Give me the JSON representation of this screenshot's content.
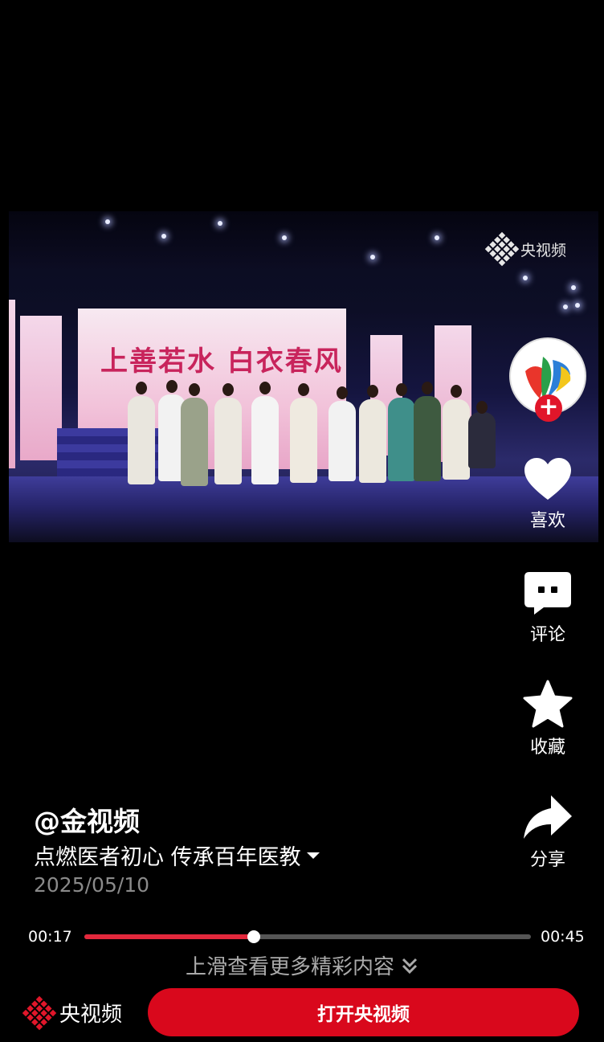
{
  "video": {
    "watermark": "央视频",
    "banner_title": "上善若水 白衣春风"
  },
  "actions": {
    "like_label": "喜欢",
    "comment_label": "评论",
    "favorite_label": "收藏",
    "share_label": "分享"
  },
  "post": {
    "author": "@金视频",
    "caption": "点燃医者初心 传承百年医教",
    "date": "2025/05/10"
  },
  "player": {
    "current_time": "00:17",
    "total_time": "00:45",
    "progress": 0.38
  },
  "swipe_hint": "上滑查看更多精彩内容",
  "bottom_bar": {
    "brand": "央视频",
    "open_button": "打开央视频"
  },
  "colors": {
    "accent": "#d9081c",
    "progress": "#e3283c"
  },
  "icons": [
    "heart-icon",
    "comment-icon",
    "star-icon",
    "share-icon",
    "chevron-down-icon",
    "double-chevron-down-icon",
    "cctv-logo-icon"
  ]
}
